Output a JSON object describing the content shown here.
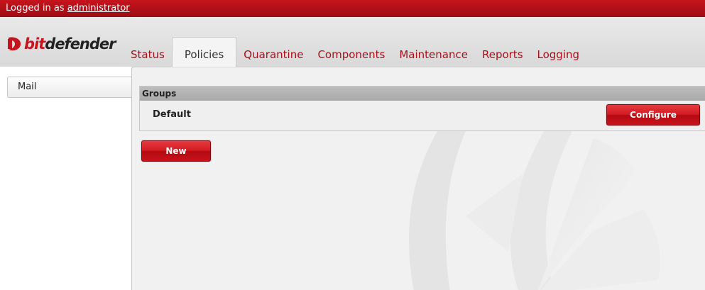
{
  "topbar": {
    "prefix": "Logged in as",
    "user": "administrator"
  },
  "logo": {
    "text_bit": "bit",
    "text_rest": "defender"
  },
  "tabs": [
    {
      "label": "Status",
      "active": false
    },
    {
      "label": "Policies",
      "active": true
    },
    {
      "label": "Quarantine",
      "active": false
    },
    {
      "label": "Components",
      "active": false
    },
    {
      "label": "Maintenance",
      "active": false
    },
    {
      "label": "Reports",
      "active": false
    },
    {
      "label": "Logging",
      "active": false
    }
  ],
  "sidebar": {
    "items": [
      {
        "label": "Mail"
      }
    ]
  },
  "groups": {
    "header": "Groups",
    "rows": [
      {
        "name": "Default",
        "action_label": "Configure"
      }
    ]
  },
  "actions": {
    "new_label": "New"
  },
  "colors": {
    "brand_red": "#c6141d",
    "tab_text": "#a8101a"
  }
}
